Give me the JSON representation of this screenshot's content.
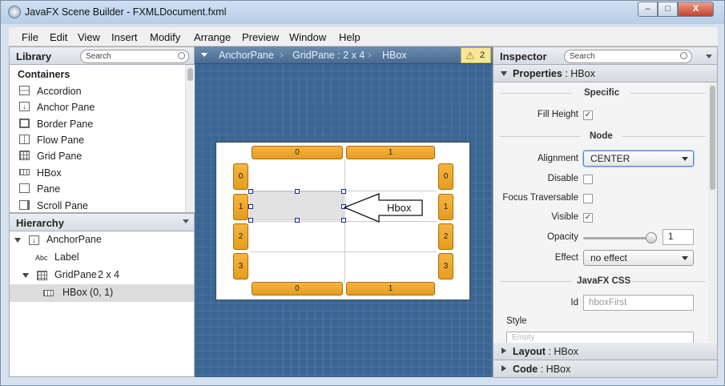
{
  "window": {
    "title": "JavaFX Scene Builder - FXMLDocument.fxml",
    "min": "–",
    "max": "□",
    "close": "X"
  },
  "menu": [
    "File",
    "Edit",
    "View",
    "Insert",
    "Modify",
    "Arrange",
    "Preview",
    "Window",
    "Help"
  ],
  "library": {
    "title": "Library",
    "search_placeholder": "Search",
    "section": "Containers",
    "items": [
      "Accordion",
      "Anchor Pane",
      "Border Pane",
      "Flow Pane",
      "Grid Pane",
      "HBox",
      "Pane",
      "Scroll Pane"
    ]
  },
  "hierarchy": {
    "title": "Hierarchy",
    "rows": [
      {
        "label": "AnchorPane"
      },
      {
        "prefix": "Abc",
        "label": "Label"
      },
      {
        "label": "GridPane",
        "suffix": "2 x 4"
      },
      {
        "label": "HBox (0, 1)"
      }
    ]
  },
  "breadcrumb": {
    "items": [
      "AnchorPane",
      "GridPane : 2 x 4",
      "HBox"
    ],
    "warning_count": "2"
  },
  "canvas": {
    "col_labels": [
      "0",
      "1"
    ],
    "row_labels": [
      "0",
      "1",
      "2",
      "3"
    ],
    "callout": "Hbox"
  },
  "inspector": {
    "title": "Inspector",
    "search_placeholder": "Search",
    "properties": {
      "name": "Properties",
      "target": "HBox"
    },
    "specific": {
      "title": "Specific",
      "fill_height_label": "Fill Height",
      "fill_height": true
    },
    "node": {
      "title": "Node",
      "alignment_label": "Alignment",
      "alignment": "CENTER",
      "disable_label": "Disable",
      "disable": false,
      "focus_label": "Focus Traversable",
      "focus": false,
      "visible_label": "Visible",
      "visible": true,
      "opacity_label": "Opacity",
      "opacity": "1",
      "effect_label": "Effect",
      "effect": "no effect"
    },
    "css": {
      "title": "JavaFX CSS",
      "id_label": "Id",
      "id_placeholder": "hboxFirst",
      "style_label": "Style",
      "style_placeholder": "Empty"
    },
    "layout": {
      "name": "Layout",
      "target": "HBox"
    },
    "code": {
      "name": "Code",
      "target": "HBox"
    }
  }
}
